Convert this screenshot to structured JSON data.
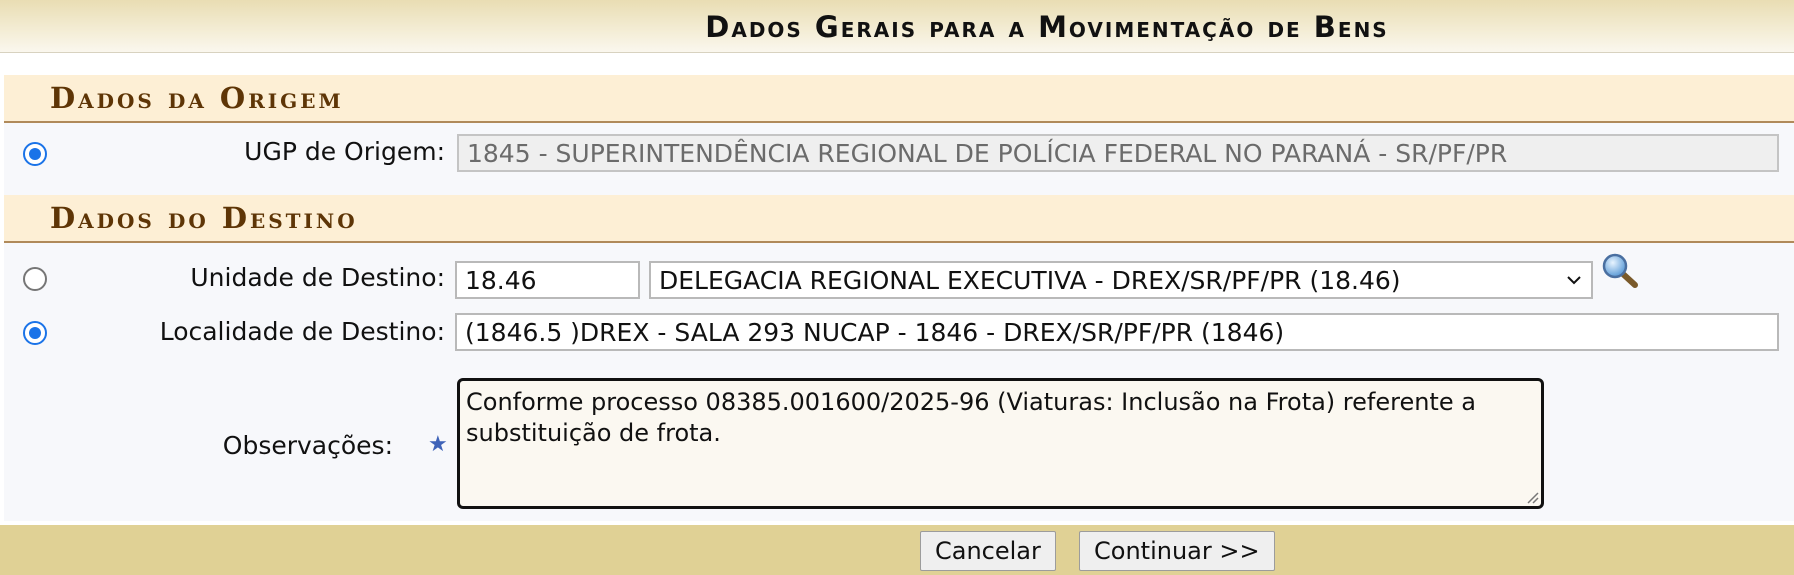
{
  "page_title": "Dados Gerais para a Movimentação de Bens",
  "origem": {
    "section_title": "Dados da Origem",
    "ugp_label": "UGP de Origem:",
    "ugp_value": "1845 - SUPERINTENDÊNCIA REGIONAL DE POLÍCIA FEDERAL NO PARANÁ - SR/PF/PR",
    "radio_selected": true
  },
  "destino": {
    "section_title": "Dados do Destino",
    "unidade_label": "Unidade de Destino:",
    "unidade_code": "18.46",
    "unidade_select": "DELEGACIA REGIONAL EXECUTIVA - DREX/SR/PF/PR (18.46)",
    "unidade_radio_selected": false,
    "localidade_label": "Localidade de Destino:",
    "localidade_value": "(1846.5 )DREX - SALA 293 NUCAP - 1846 - DREX/SR/PF/PR (1846)",
    "localidade_radio_selected": true,
    "search_icon": "magnifier-icon"
  },
  "observacoes": {
    "label": "Observações:",
    "value": "Conforme processo 08385.001600/2025-96 (Viaturas: Inclusão na Frota) referente a substituição de frota.",
    "required_icon": "star-icon"
  },
  "buttons": {
    "cancel": "Cancelar",
    "continue": "Continuar >>"
  },
  "colors": {
    "section_title": "#5e3506",
    "section_bg": "#fdefd5",
    "footer_bg": "#e0d195",
    "radio_accent": "#1a73e8"
  }
}
